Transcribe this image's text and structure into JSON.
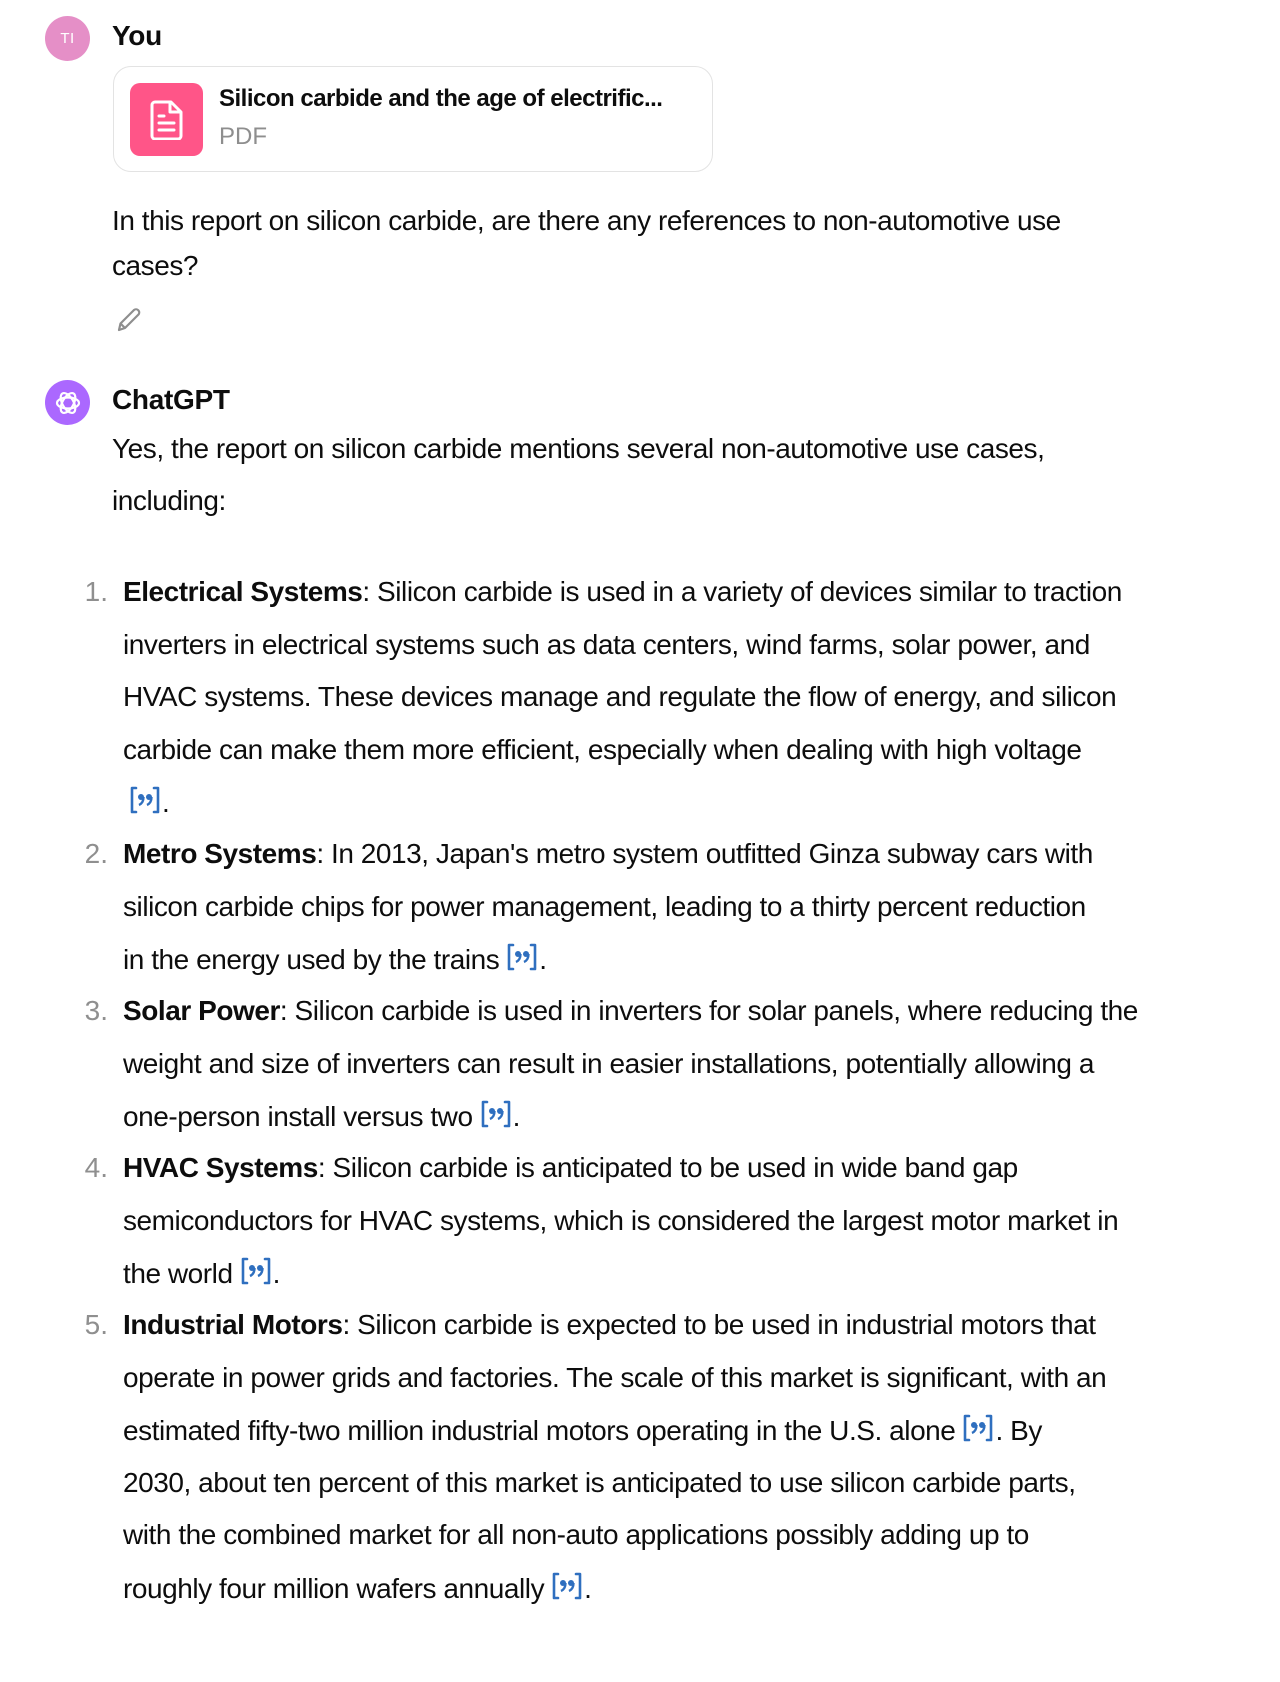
{
  "user": {
    "avatar_initials": "TI",
    "avatar_color": "#e58fc7",
    "name": "You",
    "attachment": {
      "icon": "document-icon",
      "title": "Silicon carbide and the age of electrific...",
      "type": "PDF",
      "icon_color": "#ff5588"
    },
    "question_lines": [
      "In this report on silicon carbide, are there any references to non-automotive use",
      "cases?"
    ],
    "edit_icon": "pencil-icon"
  },
  "assistant": {
    "avatar_icon": "openai-logo-icon",
    "avatar_color": "#ab68ff",
    "name": "ChatGPT",
    "intro_lines": [
      "Yes, the report on silicon carbide mentions several non-automotive use cases,",
      "including:"
    ],
    "citation_color": "#2f6fbf",
    "items": [
      {
        "number": "1.",
        "title": "Electrical Systems",
        "lines": [
          ": Silicon carbide is used in a variety of devices similar to traction",
          "inverters in electrical systems such as data centers, wind farms, solar power, and",
          "HVAC systems. These devices manage and regulate the flow of energy, and silicon",
          "carbide can make them more efficient, especially when dealing with high voltage",
          ""
        ]
      },
      {
        "number": "2.",
        "title": "Metro Systems",
        "lines": [
          ": In 2013, Japan's metro system outfitted Ginza subway cars with",
          "silicon carbide chips for power management, leading to a thirty percent reduction",
          "in the energy used by the trains"
        ]
      },
      {
        "number": "3.",
        "title": "Solar Power",
        "lines": [
          ": Silicon carbide is used in inverters for solar panels, where reducing the",
          "weight and size of inverters can result in easier installations, potentially allowing a",
          "one-person install versus two"
        ]
      },
      {
        "number": "4.",
        "title": "HVAC Systems",
        "lines": [
          ": Silicon carbide is anticipated to be used in wide band gap",
          "semiconductors for HVAC systems, which is considered the largest motor market in",
          "the world"
        ]
      },
      {
        "number": "5.",
        "title": "Industrial Motors",
        "lines": [
          ": Silicon carbide is expected to be used in industrial motors that",
          "operate in power grids and factories. The scale of this market is significant, with an",
          "estimated fifty-two million industrial motors operating in the U.S. alone",
          "2030, about ten percent of this market is anticipated to use silicon carbide parts,",
          "with the combined market for all non-auto applications possibly adding up to",
          "roughly four million wafers annually"
        ],
        "mid_line_suffix": ". By"
      }
    ],
    "punct": "."
  }
}
